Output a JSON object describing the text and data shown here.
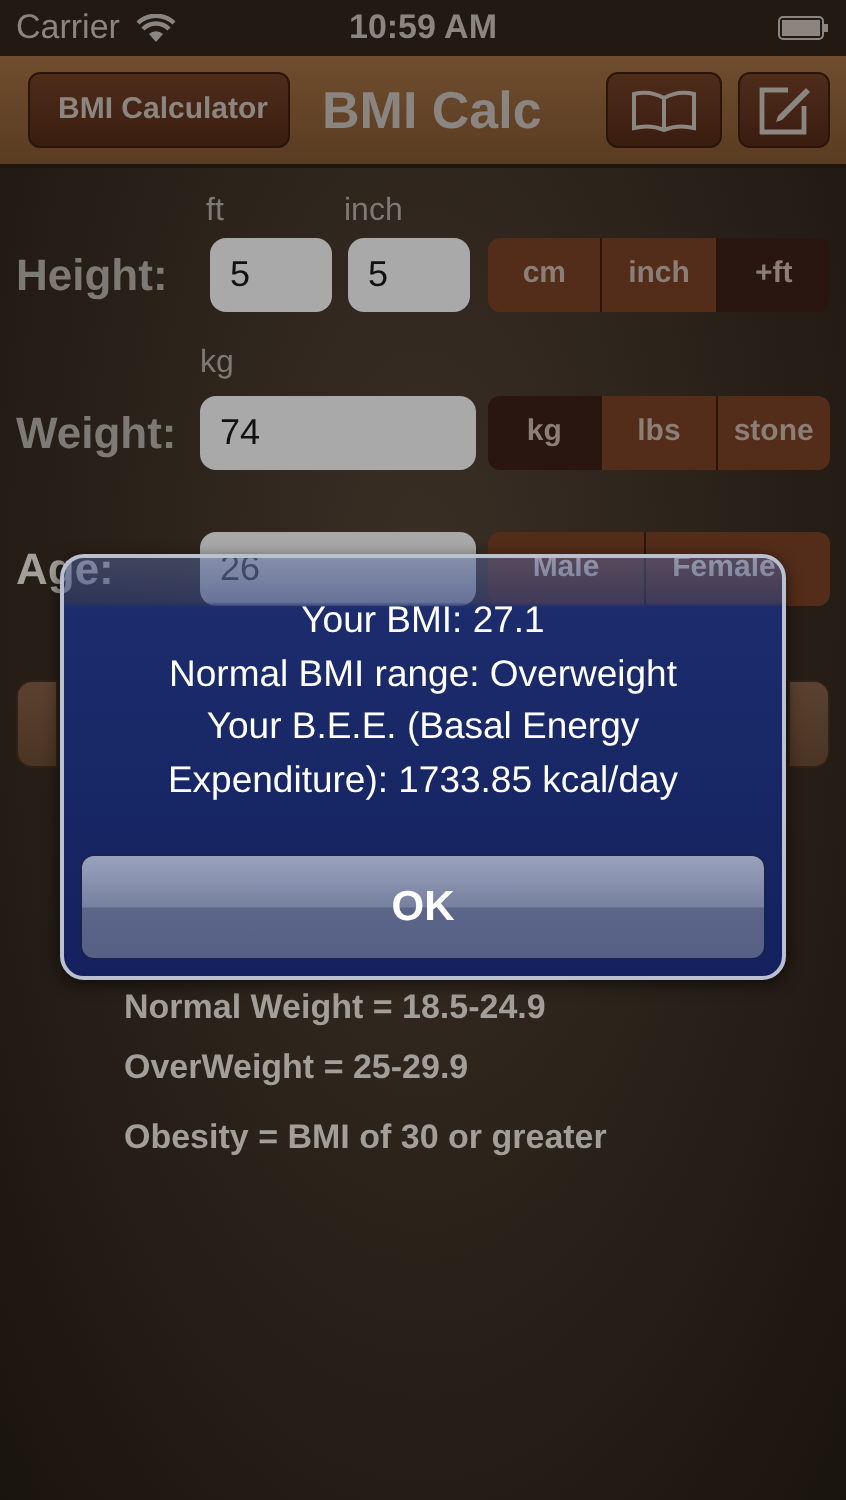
{
  "status_bar": {
    "carrier": "Carrier",
    "time": "10:59 AM"
  },
  "nav_bar": {
    "back_button": "BMI Calculator",
    "title": "BMI Calc"
  },
  "height": {
    "label": "Height:",
    "fields": [
      {
        "caption": "ft",
        "value": "5"
      },
      {
        "caption": "inch",
        "value": "5"
      }
    ],
    "units": [
      {
        "label": "cm",
        "selected": false
      },
      {
        "label": "inch",
        "selected": false
      },
      {
        "label": "+ft",
        "selected": true
      }
    ]
  },
  "weight": {
    "label": "Weight:",
    "caption": "kg",
    "value": "74",
    "units": [
      {
        "label": "kg",
        "selected": true
      },
      {
        "label": "lbs",
        "selected": false
      },
      {
        "label": "stone",
        "selected": false
      }
    ]
  },
  "age": {
    "label": "Age:",
    "value": "26",
    "genders": [
      {
        "label": "Male",
        "selected": false
      },
      {
        "label": "Female",
        "selected": false
      }
    ]
  },
  "categories": {
    "items": [
      "Normal Weight = 18.5-24.9",
      "OverWeight = 25-29.9",
      "Obesity = BMI of 30 or greater"
    ]
  },
  "alert": {
    "messages": [
      "Your BMI: 27.1",
      "Normal BMI range: Overweight",
      "Your B.E.E. (Basal Energy Expenditure): 1733.85 kcal/day"
    ],
    "button": "OK"
  }
}
